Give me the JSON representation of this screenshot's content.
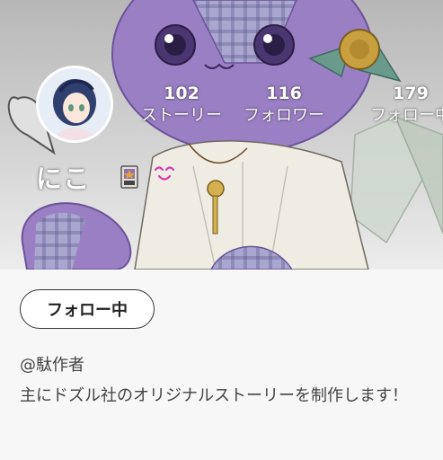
{
  "profile": {
    "name": "にこ",
    "stats": [
      {
        "value": "102",
        "label": "ストーリー"
      },
      {
        "value": "116",
        "label": "フォロワー"
      },
      {
        "value": "179",
        "label": "フォロー中"
      }
    ],
    "follow_button_label": "フォロー中",
    "author_line": "@駄作者",
    "bio": "主にドズル社のオリジナルストーリーを制作します！"
  },
  "icons": {
    "avatar": "avatar-icon",
    "badge": "card-badge-icon",
    "smile": "smile-icon"
  },
  "colors": {
    "banner_purple": "#9b7fc4",
    "banner_bg": "#c9c9c9",
    "text_white": "#ffffff",
    "text_dark": "#444444"
  }
}
